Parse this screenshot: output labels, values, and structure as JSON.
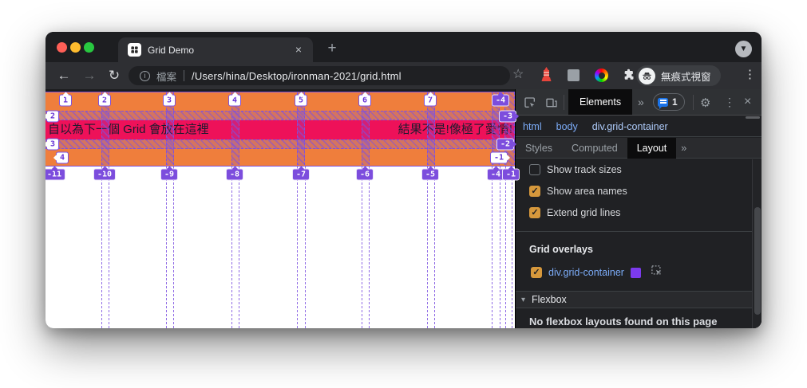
{
  "window": {
    "tab_title": "Grid Demo",
    "tab_close": "×",
    "new_tab_button": "+"
  },
  "toolbar": {
    "back": "←",
    "forward": "→",
    "reload": "↻",
    "scheme_label": "檔案",
    "url": "/Users/hina/Desktop/ironman-2021/grid.html",
    "incognito_label": "無痕式視窗"
  },
  "page": {
    "grid_item_1": "自以為下一個 Grid 會放在這裡",
    "grid_item_2": "結果不是!像極了愛情!",
    "grid_lines": {
      "top": [
        "1",
        "2",
        "3",
        "4",
        "5",
        "6",
        "7"
      ],
      "top_right": "-4",
      "left": [
        "2",
        "3",
        "4"
      ],
      "right_purple": [
        "-3",
        "-2"
      ],
      "right_white": "-1",
      "bottom": [
        "-11",
        "-10",
        "-9",
        "-8",
        "-7",
        "-6",
        "-5",
        "-4",
        "-1"
      ]
    },
    "colors": {
      "container_orange": "#ef7e3c",
      "item_pink": "#ee1159",
      "overlay_purple": "#7d51e0"
    }
  },
  "devtools": {
    "toolbar": {
      "elements_tab": "Elements",
      "more_panels": "»",
      "issues_count": "1"
    },
    "breadcrumb": [
      "html",
      "body",
      "div.grid-container"
    ],
    "tabs": {
      "styles": "Styles",
      "computed": "Computed",
      "layout": "Layout",
      "more": "»"
    },
    "layout_pane": {
      "checkboxes": [
        {
          "label": "Show track sizes",
          "checked": false
        },
        {
          "label": "Show area names",
          "checked": true
        },
        {
          "label": "Extend grid lines",
          "checked": true
        }
      ],
      "grid_overlays_title": "Grid overlays",
      "overlay_item": {
        "label": "div.grid-container",
        "checked": true,
        "color": "#7c3aed"
      },
      "flexbox_title": "Flexbox",
      "flexbox_empty": "No flexbox layouts found on this page"
    }
  }
}
